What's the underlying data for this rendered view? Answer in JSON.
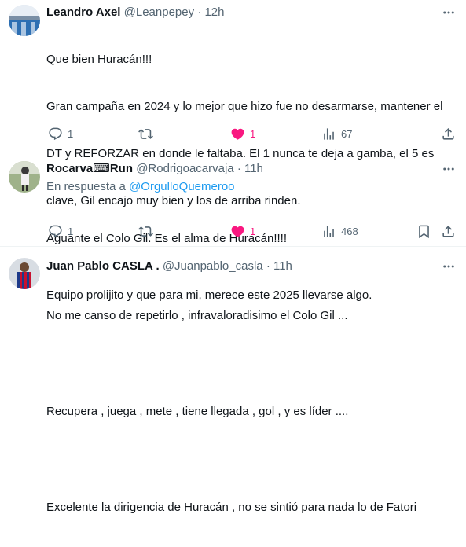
{
  "tweets": [
    {
      "name": "Leandro Axel",
      "handle": "@Leanpepey",
      "time": "· 12h",
      "lines": [
        "Que bien Huracán!!!",
        "Gran campaña en 2024 y lo mejor que hizo fue no desarmarse, mantener el",
        "DT y REFORZAR en donde le faltaba. El 1 nunca te deja a gamba, el 5 es",
        "clave, Gil encajo muy bien y los de arriba rinden.",
        "",
        "Equipo prolijito y que para mi, merece este 2025 llevarse algo."
      ],
      "replies": "1",
      "retweets": "",
      "likes": "1",
      "views": "67"
    },
    {
      "name": "Rocarva⌨Run",
      "handle": "@Rodrigoacarvaja",
      "time": "· 11h",
      "reply_prefix": "En respuesta a",
      "reply_handle": "@OrgulloQuemeroo",
      "lines": [
        "Aguante el Colo Gil. Es el alma de Huracán!!!!"
      ],
      "replies": "1",
      "retweets": "",
      "likes": "1",
      "views": "468"
    },
    {
      "name": "Juan Pablo CASLA .",
      "handle": "@Juanpablo_casla",
      "time": "· 11h",
      "lines": [
        "No me canso de repetirlo , infravaloradisimo el Colo Gil ...",
        "",
        "Recupera , juega , mete , tiene llegada , gol , y es líder ....",
        "",
        "Excelente la dirigencia de Huracán , no se sintió para nada lo de Fatori"
      ]
    }
  ],
  "colors": {
    "text": "#0f1419",
    "muted": "#536471",
    "link": "#1d9bf0",
    "like": "#f91880",
    "separator": "#eff3f4"
  },
  "icons": [
    "more-icon",
    "reply-icon",
    "retweet-icon",
    "like-icon",
    "views-icon",
    "share-icon"
  ]
}
